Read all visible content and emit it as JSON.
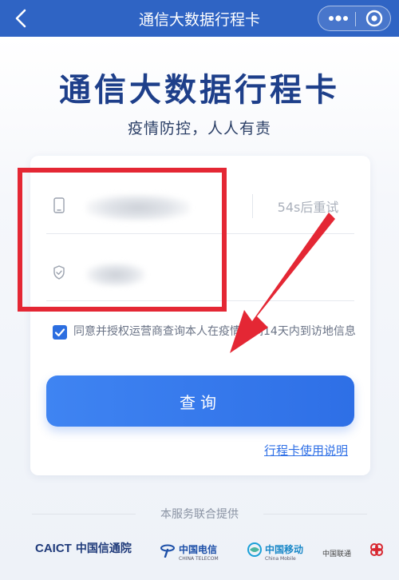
{
  "header": {
    "title": "通信大数据行程卡"
  },
  "hero": {
    "title": "通信大数据行程卡",
    "subtitle": "疫情防控，人人有责"
  },
  "form": {
    "phone_value": "",
    "code_value": "",
    "resend_label": "54s后重试",
    "consent_text": "同意并授权运营商查询本人在疫情期间14天内到访地信息",
    "consent_checked": true,
    "query_label": "查询",
    "help_link": "行程卡使用说明"
  },
  "footer": {
    "provided_by": "本服务联合提供",
    "logos": {
      "caict_en": "CAICT",
      "caict_cn": "中国信通院",
      "telecom_cn": "中国电信",
      "telecom_en": "CHINA TELECOM",
      "mobile_cn": "中国移动",
      "mobile_en": "China Mobile",
      "unicom_cn": "中国联通"
    }
  },
  "colors": {
    "topbar": "#2f64c4",
    "title": "#1e3f8a",
    "primary": "#2e6fe6",
    "annotation_red": "#e42734"
  },
  "icons": {
    "back": "chevron-left-icon",
    "more": "more-dots-icon",
    "close": "target-circle-icon",
    "phone": "phone-icon",
    "shield": "shield-check-icon",
    "check": "checkbox-checked-icon",
    "arrow": "red-arrow-annotation"
  }
}
